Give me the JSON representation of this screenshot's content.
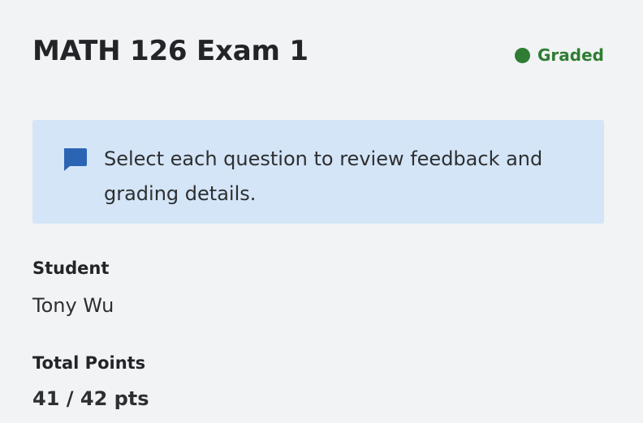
{
  "exam": {
    "title": "MATH 126 Exam 1",
    "status": {
      "label": "Graded",
      "color": "#2e7d32",
      "icon": "status-dot-icon"
    }
  },
  "notice": {
    "icon": "comment-icon",
    "text": "Select each question to review feedback and grading details."
  },
  "student": {
    "label": "Student",
    "name": "Tony Wu"
  },
  "points": {
    "label": "Total Points",
    "value": "41 / 42 pts"
  }
}
